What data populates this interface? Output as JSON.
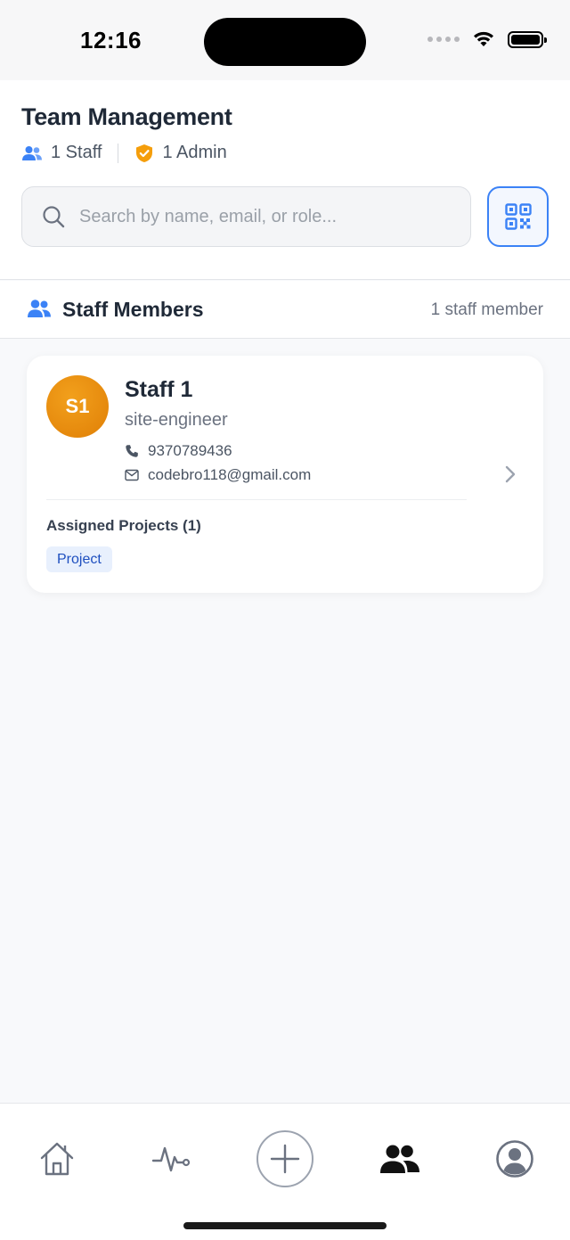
{
  "status_bar": {
    "time": "12:16"
  },
  "header": {
    "title": "Team Management",
    "staff_count_label": "1 Staff",
    "admin_count_label": "1 Admin",
    "search": {
      "placeholder": "Search by name, email, or role...",
      "value": ""
    }
  },
  "section": {
    "title": "Staff Members",
    "count_label": "1 staff member"
  },
  "staff": [
    {
      "initials": "S1",
      "name": "Staff 1",
      "role": "site-engineer",
      "phone": "9370789436",
      "email": "codebro118@gmail.com",
      "assigned_label": "Assigned Projects (1)",
      "projects": [
        "Project"
      ]
    }
  ],
  "colors": {
    "accent": "#3b82f6",
    "admin_badge": "#f59e0b",
    "avatar": "#e8890b",
    "chip_bg": "#e8f0fd",
    "chip_text": "#1e4fbf"
  },
  "tabbar": {
    "items": [
      {
        "icon": "home-icon",
        "active": false
      },
      {
        "icon": "activity-icon",
        "active": false
      },
      {
        "icon": "add-icon",
        "active": false
      },
      {
        "icon": "team-icon",
        "active": true
      },
      {
        "icon": "profile-icon",
        "active": false
      }
    ]
  }
}
